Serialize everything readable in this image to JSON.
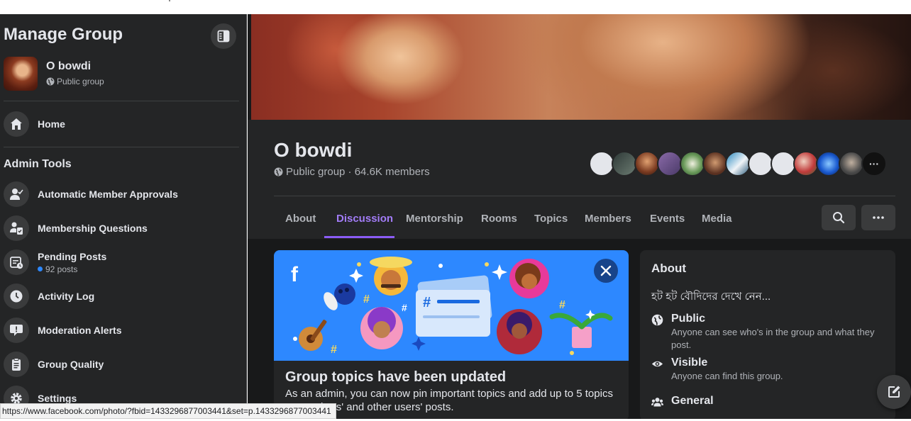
{
  "sidebar": {
    "title": "Manage Group",
    "group": {
      "name": "O bowdi",
      "privacy": "Public group"
    },
    "home_label": "Home",
    "admin_tools_heading": "Admin Tools",
    "items": [
      {
        "label": "Automatic Member Approvals",
        "icon": "person-check-icon"
      },
      {
        "label": "Membership Questions",
        "icon": "person-clipboard-icon"
      },
      {
        "label": "Pending Posts",
        "sub": "92 posts",
        "icon": "pending-posts-icon"
      },
      {
        "label": "Activity Log",
        "icon": "clock-icon"
      },
      {
        "label": "Moderation Alerts",
        "icon": "alert-bubble-icon"
      },
      {
        "label": "Group Quality",
        "icon": "clipboard-icon"
      },
      {
        "label": "Settings",
        "icon": "gear-icon"
      }
    ]
  },
  "group_header": {
    "name": "O bowdi",
    "meta": "Public group · 64.6K members",
    "member_avatar_count": 13
  },
  "tabs": [
    {
      "label": "About",
      "active": false
    },
    {
      "label": "Discussion",
      "active": true
    },
    {
      "label": "Mentorship",
      "active": false
    },
    {
      "label": "Rooms",
      "active": false
    },
    {
      "label": "Topics",
      "active": false
    },
    {
      "label": "Members",
      "active": false
    },
    {
      "label": "Events",
      "active": false
    },
    {
      "label": "Media",
      "active": false
    }
  ],
  "banner": {
    "title": "Group topics have been updated",
    "text": "As an admin, you can now pin important topics and add up to 5 topics to members' and other users' posts.",
    "brand_letter": "f"
  },
  "about": {
    "heading": "About",
    "description": "হট হট বৌদিদের দেখে নেন...",
    "items": [
      {
        "title": "Public",
        "desc": "Anyone can see who's in the group and what they post.",
        "icon": "globe-icon"
      },
      {
        "title": "Visible",
        "desc": "Anyone can find this group.",
        "icon": "eye-icon"
      },
      {
        "title": "General",
        "desc": "",
        "icon": "people-icon"
      }
    ]
  },
  "status_bar": {
    "url": "https://www.facebook.com/photo/?fbid=1433296877003441&set=p.1433296877003441"
  },
  "colors": {
    "sidebar_bg": "#242526",
    "main_bg": "#18191a",
    "accent": "#8b5cf6",
    "banner_bg": "#2d88ff"
  }
}
